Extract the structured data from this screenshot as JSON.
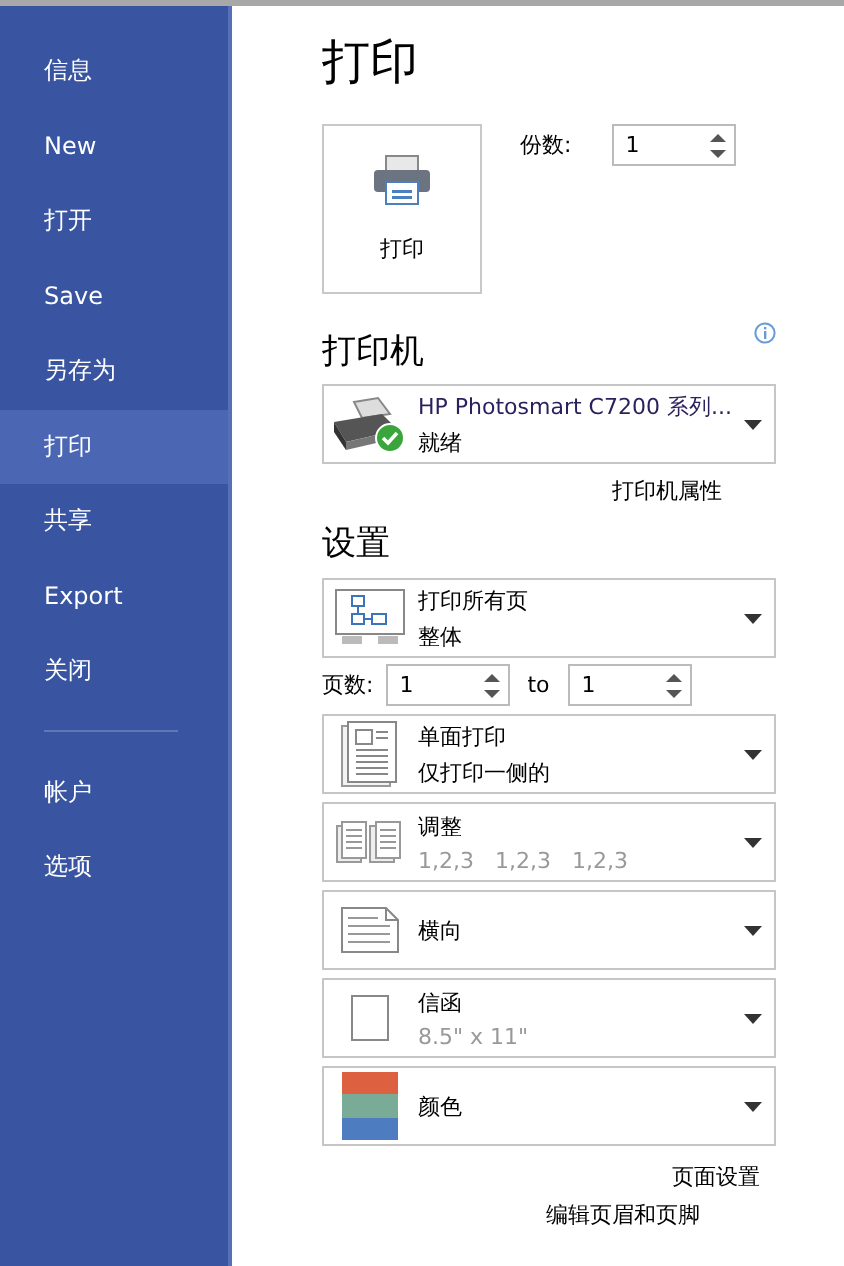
{
  "sidebar": {
    "items": [
      {
        "label": "信息",
        "selected": false
      },
      {
        "label": "New",
        "selected": false
      },
      {
        "label": "打开",
        "selected": false
      },
      {
        "label": "Save",
        "selected": false
      },
      {
        "label": "另存为",
        "selected": false
      },
      {
        "label": "打印",
        "selected": true
      },
      {
        "label": "共享",
        "selected": false
      },
      {
        "label": "Export",
        "selected": false
      },
      {
        "label": "关闭",
        "selected": false
      }
    ],
    "bottom_items": [
      {
        "label": "帐户",
        "selected": false
      },
      {
        "label": "选项",
        "selected": false
      }
    ]
  },
  "title": "打印",
  "print_button": {
    "label": "打印"
  },
  "copies": {
    "label": "份数:",
    "value": "1"
  },
  "printer": {
    "heading": "打印机",
    "name": "HP Photosmart C7200 系列...",
    "status": "就绪",
    "ready": true,
    "properties_link": "打印机属性"
  },
  "settings": {
    "heading": "设置",
    "dropdowns": [
      {
        "kind": "pages",
        "title": "打印所有页",
        "subtitle": "整体",
        "subtitle_muted": false
      },
      {
        "kind": "range",
        "label": "页数:",
        "from": "1",
        "to_label": "to",
        "to": "1"
      },
      {
        "kind": "duplex",
        "title": "单面打印",
        "subtitle": "仅打印一侧的",
        "subtitle_muted": false
      },
      {
        "kind": "collate",
        "title": "调整",
        "subtitle": "1,2,3   1,2,3   1,2,3",
        "subtitle_muted": true
      },
      {
        "kind": "orientation",
        "title": "横向"
      },
      {
        "kind": "paper",
        "title": "信函",
        "subtitle": "8.5\" x 11\"",
        "subtitle_muted": true
      },
      {
        "kind": "color",
        "title": "颜色"
      }
    ],
    "page_setup_link": "页面设置"
  },
  "header_footer_link": "编辑页眉和页脚"
}
